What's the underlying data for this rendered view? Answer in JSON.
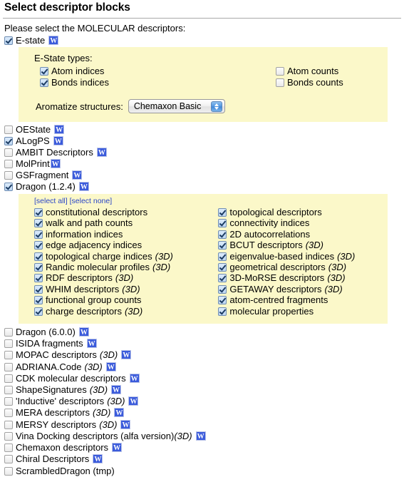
{
  "header": {
    "title": "Select descriptor blocks",
    "intro": "Please select the MOLECULAR descriptors:"
  },
  "icons": {
    "wiki": "wikipedia-w-icon",
    "w_glyph": "W"
  },
  "estate": {
    "label": "E-state",
    "checked": true,
    "has_wiki": true,
    "panel": {
      "heading": "E-State types:",
      "types_left": [
        {
          "label": "Atom indices",
          "checked": true
        },
        {
          "label": "Bonds indices",
          "checked": true
        }
      ],
      "types_right": [
        {
          "label": "Atom counts",
          "checked": false
        },
        {
          "label": "Bonds counts",
          "checked": false
        }
      ],
      "aromatize_label": "Aromatize structures:",
      "aromatize_value": "Chemaxon Basic",
      "aromatize_options": [
        "Chemaxon Basic"
      ]
    }
  },
  "mid_blocks": [
    {
      "label": "OEState",
      "checked": false,
      "has_wiki": true,
      "tight_wiki": false
    },
    {
      "label": "ALogPS",
      "checked": true,
      "has_wiki": true,
      "tight_wiki": false
    },
    {
      "label": "AMBIT Descriptors",
      "checked": false,
      "has_wiki": true,
      "tight_wiki": false
    },
    {
      "label": "MolPrint",
      "checked": false,
      "has_wiki": true,
      "tight_wiki": true
    },
    {
      "label": "GSFragment",
      "checked": false,
      "has_wiki": true,
      "tight_wiki": false
    },
    {
      "label": "Dragon (1.2.4)",
      "checked": true,
      "has_wiki": true,
      "tight_wiki": false
    }
  ],
  "dragon_panel": {
    "select_all": "[select all]",
    "select_none": "[select none]",
    "left": [
      {
        "label": "constitutional descriptors",
        "checked": true,
        "three_d": ""
      },
      {
        "label": "walk and path counts",
        "checked": true,
        "three_d": ""
      },
      {
        "label": "information indices",
        "checked": true,
        "three_d": ""
      },
      {
        "label": "edge adjacency indices",
        "checked": true,
        "three_d": ""
      },
      {
        "label": "topological charge indices",
        "checked": true,
        "three_d": "(3D)"
      },
      {
        "label": "Randic molecular profiles",
        "checked": true,
        "three_d": "(3D)"
      },
      {
        "label": "RDF descriptors",
        "checked": true,
        "three_d": "(3D)"
      },
      {
        "label": "WHIM descriptors",
        "checked": true,
        "three_d": "(3D)"
      },
      {
        "label": "functional group counts",
        "checked": true,
        "three_d": ""
      },
      {
        "label": "charge descriptors",
        "checked": true,
        "three_d": "(3D)"
      }
    ],
    "right": [
      {
        "label": "topological descriptors",
        "checked": true,
        "three_d": ""
      },
      {
        "label": "connectivity indices",
        "checked": true,
        "three_d": ""
      },
      {
        "label": "2D autocorrelations",
        "checked": true,
        "three_d": ""
      },
      {
        "label": "BCUT descriptors",
        "checked": true,
        "three_d": "(3D)"
      },
      {
        "label": "eigenvalue-based indices",
        "checked": true,
        "three_d": "(3D)"
      },
      {
        "label": "geometrical descriptors",
        "checked": true,
        "three_d": "(3D)"
      },
      {
        "label": "3D-MoRSE descriptors",
        "checked": true,
        "three_d": "(3D)"
      },
      {
        "label": "GETAWAY descriptors",
        "checked": true,
        "three_d": "(3D)"
      },
      {
        "label": "atom-centred fragments",
        "checked": true,
        "three_d": ""
      },
      {
        "label": "molecular properties",
        "checked": true,
        "three_d": ""
      }
    ]
  },
  "bottom_blocks": [
    {
      "label": "Dragon (6.0.0)",
      "checked": false,
      "three_d": "",
      "has_wiki": true
    },
    {
      "label": "ISIDA fragments",
      "checked": false,
      "three_d": "",
      "has_wiki": true
    },
    {
      "label": "MOPAC descriptors",
      "checked": false,
      "three_d": "(3D)",
      "has_wiki": true
    },
    {
      "label": "ADRIANA.Code",
      "checked": false,
      "three_d": "(3D)",
      "has_wiki": true
    },
    {
      "label": "CDK molecular descriptors",
      "checked": false,
      "three_d": "",
      "has_wiki": true
    },
    {
      "label": "ShapeSignatures",
      "checked": false,
      "three_d": "(3D)",
      "has_wiki": true
    },
    {
      "label": "'Inductive' descriptors",
      "checked": false,
      "three_d": "(3D)",
      "has_wiki": true
    },
    {
      "label": "MERA descriptors",
      "checked": false,
      "three_d": "(3D)",
      "has_wiki": true
    },
    {
      "label": "MERSY descriptors",
      "checked": false,
      "three_d": "(3D)",
      "has_wiki": true
    },
    {
      "label": "Vina Docking descriptors (alfa version)",
      "checked": false,
      "three_d": "(3D)",
      "has_wiki": true,
      "tight_3d": true
    },
    {
      "label": "Chemaxon descriptors",
      "checked": false,
      "three_d": "",
      "has_wiki": true
    },
    {
      "label": "Chiral Descriptors",
      "checked": false,
      "three_d": "",
      "has_wiki": true
    },
    {
      "label": "ScrambledDragon (tmp)",
      "checked": false,
      "three_d": "",
      "has_wiki": false
    }
  ],
  "colors": {
    "panel_bg": "#fbf8c9",
    "link_blue": "#2a45c8",
    "wiki_blue": "#3b5bdb"
  }
}
